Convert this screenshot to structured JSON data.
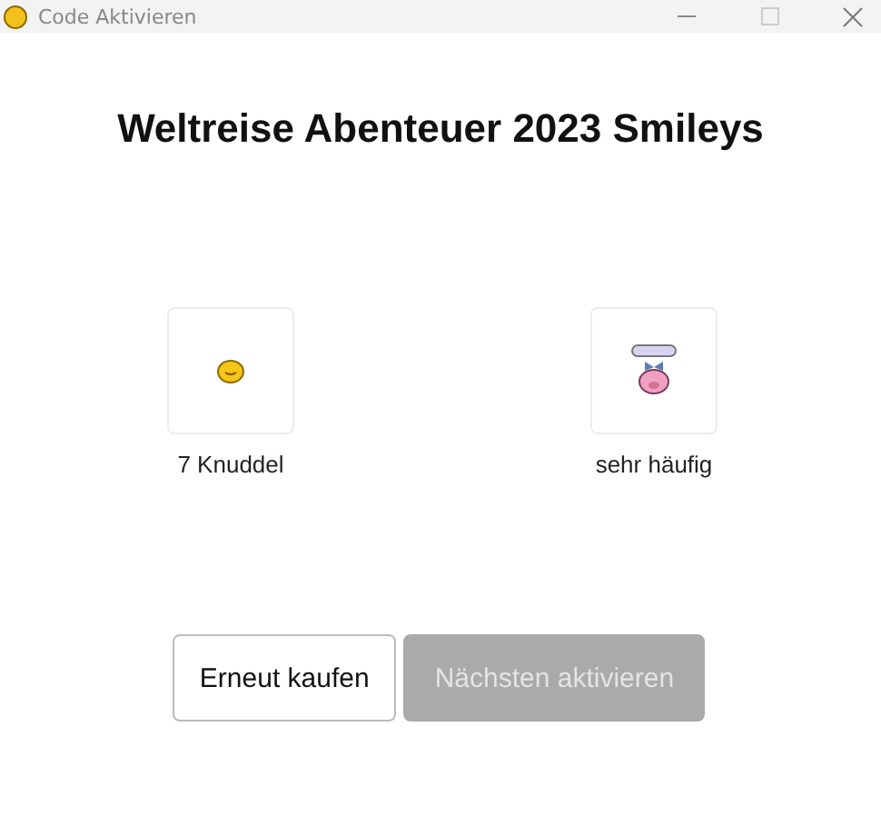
{
  "window": {
    "title": "Code Aktivieren"
  },
  "heading": "Weltreise Abenteuer 2023 Smileys",
  "items": [
    {
      "label": "7 Knuddel",
      "kind": "chick"
    },
    {
      "label": "sehr häufig",
      "kind": "pig"
    }
  ],
  "buttons": [
    {
      "label": "Erneut kaufen",
      "disabled": false
    },
    {
      "label": "Nächsten aktivieren",
      "disabled": true
    }
  ]
}
